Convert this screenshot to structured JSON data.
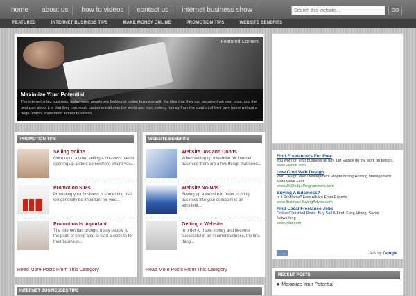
{
  "topnav": [
    "home",
    "about us",
    "how to videos",
    "contact us",
    "internet business show"
  ],
  "search": {
    "placeholder": "Search this website...",
    "button": "GO"
  },
  "catnav": [
    "FEATURED",
    "INTERNET BUSINESS TIPS",
    "MAKE MONEY ONLINE",
    "PROMOTION TIPS",
    "WEBSITE BENEFITS"
  ],
  "featured": {
    "label": "Featured Content",
    "title": "Maximize Your Potential",
    "text": "The internet is big business, today more people are looking at online business with the idea that they can become their own boss, and the best part about it is that they can reach customers all over the world and start making money from the comfort of their own home without a huge upfront investment in their business."
  },
  "promotion": {
    "heading": "PROMOTION TIPS",
    "posts": [
      {
        "title": "Selling online",
        "text": "Once upon a time, selling a business meant opening up a store somewhere where you..."
      },
      {
        "title": "Promotion Sites",
        "text": "Promoting your business is something that will generally be important for your..."
      },
      {
        "title": "Promotion Is Important",
        "text": "The internet has brought many people to the point of being able to start a website for their business..."
      }
    ],
    "readmore": "Read More Posts From This Category"
  },
  "website": {
    "heading": "WEBSITE BENEFITS",
    "posts": [
      {
        "title": "Website Dos and Don'ts",
        "text": "When setting up a website for internet business there are a few things that need..."
      },
      {
        "title": "Website No-Nos",
        "text": "Setting up a website in order to bring business into your company is an excellent..."
      },
      {
        "title": "Getting a Website",
        "text": "In order to make money and become successful in an internet business, the first thing..."
      }
    ],
    "readmore": "Read More Posts From This Category"
  },
  "bottom": {
    "heading": "INTERNET BUSINESSES TIPS"
  },
  "ads": {
    "items": [
      {
        "title": "Find Freelancers For Free",
        "desc": "You work on your business all day. Let Elance do the work on tonight.",
        "url": "www.Elance.com"
      },
      {
        "title": "Low Cost Web Design",
        "desc": "Web Design Web Development Programming Hosting Management More Work Fast.",
        "url": "www.WeDodgeProgrammers.com"
      },
      {
        "title": "Buying A Business?",
        "desc": "Is it Profitable? Free Advice From Experts.",
        "url": "www.BusinessBuyingAdvice.com"
      },
      {
        "title": "Find Local Freelance Jobs",
        "desc": "Online Classified Posts. Buy Sell & Find. Easy, Hiring. Social Networking",
        "url": "www.jobs.com"
      }
    ],
    "footer_prefix": "Ads by",
    "footer_brand": "Google"
  },
  "recent": {
    "heading": "RECENT POSTS",
    "items": [
      "Maximize Your Potential"
    ]
  }
}
